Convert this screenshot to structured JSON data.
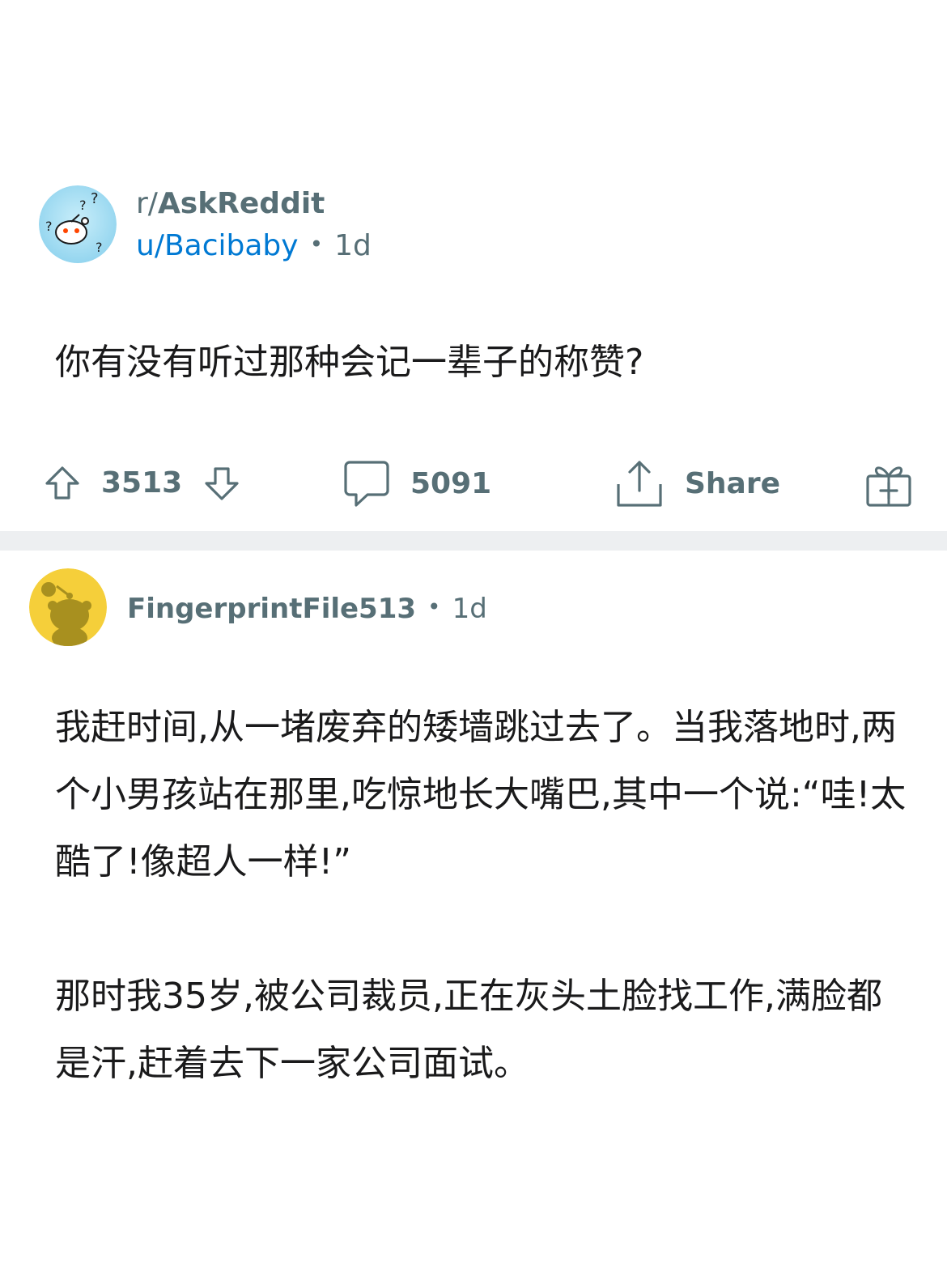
{
  "post": {
    "subreddit_prefix": "r/",
    "subreddit_name": "AskReddit",
    "author": "u/Bacibaby",
    "separator": "•",
    "time": "1d",
    "title": "你有没有听过那种会记一辈子的称赞?"
  },
  "actions": {
    "upvotes": "3513",
    "comments": "5091",
    "share_label": "Share",
    "icons": [
      "upvote-icon",
      "downvote-icon",
      "comment-icon",
      "share-icon",
      "award-icon"
    ]
  },
  "comment": {
    "author": "FingerprintFile513",
    "separator": "•",
    "time": "1d",
    "paragraphs": [
      "我赶时间,从一堵废弃的矮墙跳过去了。当我落地时,两个小男孩站在那里,吃惊地长大嘴巴,其中一个说:“哇!太酷了!像超人一样!”",
      "那时我35岁,被公司裁员,正在灰头土脸找工作,满脸都是汗,赶着去下一家公司面试。"
    ]
  },
  "colors": {
    "link": "#0079d3",
    "meta": "#576f76",
    "divider": "#edeff1",
    "post_avatar_bg": "#9fdcf2",
    "comment_avatar_bg": "#f5cf3a"
  }
}
